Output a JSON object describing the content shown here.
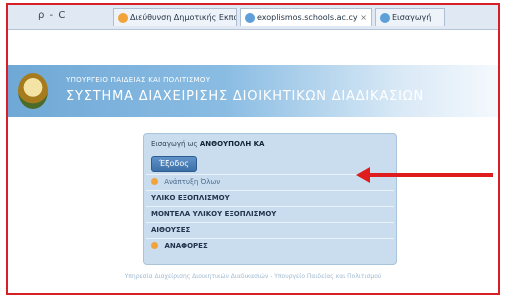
{
  "browser": {
    "nav_text": "ρ - C",
    "tabs": [
      {
        "title": "Διεύθυνση Δημοτικής Εκπαίδ...",
        "close": ""
      },
      {
        "title": "exoplismos.schools.ac.cy",
        "close": "×"
      },
      {
        "title": "Εισαγωγή",
        "close": ""
      }
    ],
    "tab_icon_colors": [
      "#f2a33a",
      "#5f9fd8",
      "#5f9fd8"
    ]
  },
  "header": {
    "ministry": "ΥΠΟΥΡΓΕΙΟ ΠΑΙΔΕΙΑΣ ΚΑΙ ΠΟΛΙΤΙΣΜΟΥ",
    "system": "ΣΥΣΤΗΜΑ ΔΙΑΧΕΙΡΙΣΗΣ ΔΙΟΙΚΗΤΙΚΩΝ ΔΙΑΔΙΚΑΣΙΩΝ"
  },
  "panel": {
    "login_prefix": "Εισαγωγή ως",
    "login_user": "ΑΝΘΟΥΠΟΛΗ ΚΑ",
    "logout_label": "Έξοδος",
    "menu": [
      {
        "label": "Ανάπτυξη Όλων",
        "has_dot": true
      },
      {
        "label": "ΥΛΙΚΟ ΕΞΟΠΛΙΣΜΟΥ",
        "has_dot": false
      },
      {
        "label": "ΜΟΝΤΕΛΑ ΥΛΙΚΟΥ ΕΞΟΠΛΙΣΜΟΥ",
        "has_dot": false
      },
      {
        "label": "ΑΙΘΟΥΣΕΣ",
        "has_dot": false
      },
      {
        "label": "ΑΝΑΦΟΡΕΣ",
        "has_dot": true
      }
    ]
  },
  "footer": "Υπηρεσία Διαχείρισης Διοικητικών Διαδικασιών - Υπουργείο Παιδείας και Πολιτισμού",
  "colors": {
    "accent_red": "#d61f26",
    "header_blue": "#6fa8d6",
    "panel_blue": "#c9ddef",
    "button_blue": "#3e70a8"
  }
}
